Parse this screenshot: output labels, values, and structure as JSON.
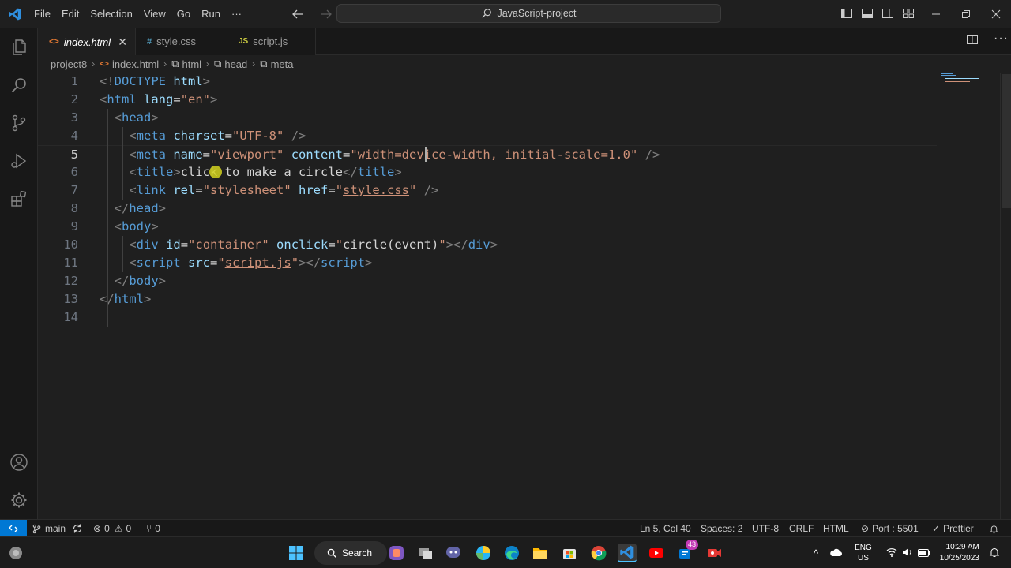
{
  "menu": [
    "File",
    "Edit",
    "Selection",
    "View",
    "Go",
    "Run",
    "···"
  ],
  "command_center": "JavaScript-project",
  "tabs": [
    {
      "icon": "<>",
      "label": "index.html",
      "close": "✕"
    },
    {
      "icon": "#",
      "label": "style.css"
    },
    {
      "icon": "JS",
      "label": "script.js"
    }
  ],
  "more_actions": "···",
  "breadcrumb": [
    "project8",
    "index.html",
    "html",
    "head",
    "meta"
  ],
  "code": {
    "line_numbers": [
      "1",
      "2",
      "3",
      "4",
      "5",
      "6",
      "7",
      "8",
      "9",
      "10",
      "11",
      "12",
      "13",
      "14"
    ],
    "lines": [
      [
        [
          "b",
          "<!"
        ],
        [
          "t",
          "DOCTYPE"
        ],
        [
          "x",
          " "
        ],
        [
          "a",
          "html"
        ],
        [
          "b",
          ">"
        ]
      ],
      [
        [
          "b",
          "<"
        ],
        [
          "t",
          "html"
        ],
        [
          "x",
          " "
        ],
        [
          "a",
          "lang"
        ],
        [
          "x",
          "="
        ],
        [
          "s",
          "\"en\""
        ],
        [
          "b",
          ">"
        ]
      ],
      [
        [
          "x",
          "  "
        ],
        [
          "b",
          "<"
        ],
        [
          "t",
          "head"
        ],
        [
          "b",
          ">"
        ]
      ],
      [
        [
          "x",
          "    "
        ],
        [
          "b",
          "<"
        ],
        [
          "t",
          "meta"
        ],
        [
          "x",
          " "
        ],
        [
          "a",
          "charset"
        ],
        [
          "x",
          "="
        ],
        [
          "s",
          "\"UTF-8\""
        ],
        [
          "x",
          " "
        ],
        [
          "b",
          "/>"
        ]
      ],
      [
        [
          "x",
          "    "
        ],
        [
          "b",
          "<"
        ],
        [
          "t",
          "meta"
        ],
        [
          "x",
          " "
        ],
        [
          "a",
          "name"
        ],
        [
          "x",
          "="
        ],
        [
          "s",
          "\"viewport\""
        ],
        [
          "x",
          " "
        ],
        [
          "a",
          "content"
        ],
        [
          "x",
          "="
        ],
        [
          "s",
          "\"width=device-width, initial-scale=1.0\""
        ],
        [
          "x",
          " "
        ],
        [
          "b",
          "/>"
        ]
      ],
      [
        [
          "x",
          "    "
        ],
        [
          "b",
          "<"
        ],
        [
          "t",
          "title"
        ],
        [
          "b",
          ">"
        ],
        [
          "x",
          "click to make a circle"
        ],
        [
          "b",
          "</"
        ],
        [
          "t",
          "title"
        ],
        [
          "b",
          ">"
        ]
      ],
      [
        [
          "x",
          "    "
        ],
        [
          "b",
          "<"
        ],
        [
          "t",
          "link"
        ],
        [
          "x",
          " "
        ],
        [
          "a",
          "rel"
        ],
        [
          "x",
          "="
        ],
        [
          "s",
          "\"stylesheet\""
        ],
        [
          "x",
          " "
        ],
        [
          "a",
          "href"
        ],
        [
          "x",
          "="
        ],
        [
          "s",
          "\""
        ],
        [
          "su",
          "style.css"
        ],
        [
          "s",
          "\""
        ],
        [
          "x",
          " "
        ],
        [
          "b",
          "/>"
        ]
      ],
      [
        [
          "x",
          "  "
        ],
        [
          "b",
          "</"
        ],
        [
          "t",
          "head"
        ],
        [
          "b",
          ">"
        ]
      ],
      [
        [
          "x",
          "  "
        ],
        [
          "b",
          "<"
        ],
        [
          "t",
          "body"
        ],
        [
          "b",
          ">"
        ]
      ],
      [
        [
          "x",
          "    "
        ],
        [
          "b",
          "<"
        ],
        [
          "t",
          "div"
        ],
        [
          "x",
          " "
        ],
        [
          "a",
          "id"
        ],
        [
          "x",
          "="
        ],
        [
          "s",
          "\"container\""
        ],
        [
          "x",
          " "
        ],
        [
          "a",
          "onclick"
        ],
        [
          "x",
          "="
        ],
        [
          "s",
          "\""
        ],
        [
          "x",
          "circle(event)"
        ],
        [
          "s",
          "\""
        ],
        [
          "b",
          "></"
        ],
        [
          "t",
          "div"
        ],
        [
          "b",
          ">"
        ]
      ],
      [
        [
          "x",
          "    "
        ],
        [
          "b",
          "<"
        ],
        [
          "t",
          "script"
        ],
        [
          "x",
          " "
        ],
        [
          "a",
          "src"
        ],
        [
          "x",
          "="
        ],
        [
          "s",
          "\""
        ],
        [
          "su",
          "script.js"
        ],
        [
          "s",
          "\""
        ],
        [
          "b",
          "></"
        ],
        [
          "t",
          "script"
        ],
        [
          "b",
          ">"
        ]
      ],
      [
        [
          "x",
          "  "
        ],
        [
          "b",
          "</"
        ],
        [
          "t",
          "body"
        ],
        [
          "b",
          ">"
        ]
      ],
      [
        [
          "b",
          "</"
        ],
        [
          "t",
          "html"
        ],
        [
          "b",
          ">"
        ]
      ],
      []
    ]
  },
  "status": {
    "branch": "main",
    "errors": "0",
    "warnings": "0",
    "ports": "0",
    "cursor_position": "Ln 5, Col 40",
    "indent": "Spaces: 2",
    "encoding": "UTF-8",
    "eol": "CRLF",
    "language": "HTML",
    "port": "Port : 5501",
    "formatter": "Prettier"
  },
  "taskbar": {
    "search_label": "Search",
    "badge": "43",
    "lang_top": "ENG",
    "lang_bottom": "US",
    "time": "10:29 AM",
    "date": "10/25/2023"
  },
  "colors": {
    "accent": "#0078d4",
    "tag": "#569cd6",
    "attribute": "#9cdcfe",
    "string": "#ce9178"
  }
}
